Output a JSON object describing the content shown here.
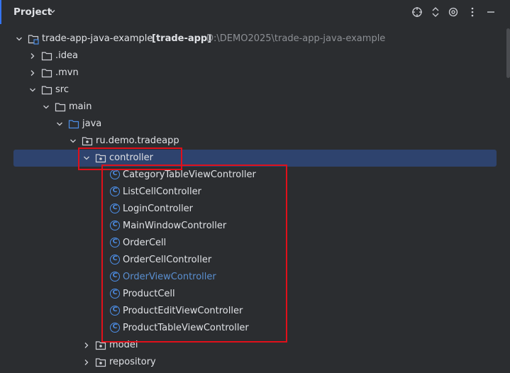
{
  "header": {
    "title": "Project",
    "toolbar": [
      "locate-icon",
      "expand-collapse-icon",
      "settings-icon",
      "more-options-icon",
      "minimize-icon"
    ]
  },
  "tree": {
    "root": {
      "name": "trade-app-java-example",
      "module": "[trade-app]",
      "path": "D:\\DEMO2025\\trade-app-java-example"
    },
    "idea": ".idea",
    "mvn": ".mvn",
    "src": "src",
    "main": "main",
    "java": "java",
    "package": "ru.demo.tradeapp",
    "controller": "controller",
    "classes": [
      "CategoryTableViewController",
      "ListCellController",
      "LoginController",
      "MainWindowController",
      "OrderCell",
      "OrderCellController",
      "OrderViewController",
      "ProductCell",
      "ProductEditViewController",
      "ProductTableViewController"
    ],
    "class_icon_letter": "C",
    "model": "model",
    "repository": "repository"
  },
  "colors": {
    "background": "#2b2d30",
    "selection": "#2e436e",
    "highlight": "#e0101a",
    "class_icon": "#4d8fe8"
  }
}
